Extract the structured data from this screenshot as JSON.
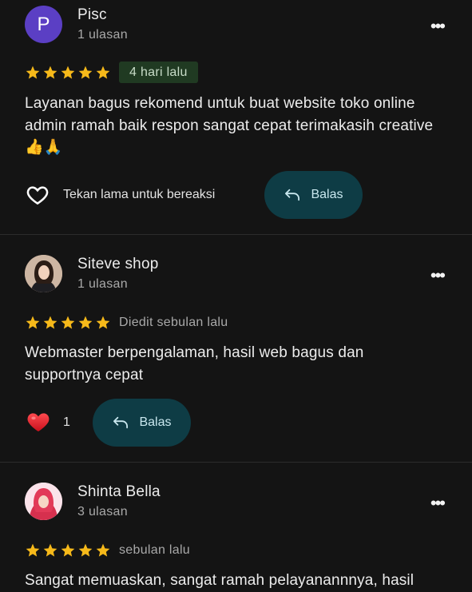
{
  "reviews": [
    {
      "avatar_letter": "P",
      "name": "Pisc",
      "count": "1 ulasan",
      "rating": 5,
      "date": "4 hari lalu",
      "text": "Layanan bagus rekomend untuk buat website toko online admin ramah baik respon sangat cepat terimakasih creative 👍🙏",
      "react_label": "Tekan lama untuk bereaksi",
      "reply_label": "Balas"
    },
    {
      "name": "Siteve shop",
      "count": "1 ulasan",
      "rating": 5,
      "date": "Diedit sebulan lalu",
      "text": "Webmaster berpengalaman, hasil web bagus dan supportnya cepat",
      "like_count": "1",
      "reply_label": "Balas"
    },
    {
      "name": "Shinta Bella",
      "count": "3 ulasan",
      "rating": 5,
      "date": "sebulan lalu",
      "text": "Sangat memuaskan, sangat ramah pelayanannnya, hasil"
    }
  ],
  "colors": {
    "background": "#141414",
    "star": "#f6b91a",
    "reply_bg": "#0e3c45",
    "badge_bg": "#203a22",
    "avatar_p": "#5b3fc4",
    "heart": "#e5202e"
  }
}
